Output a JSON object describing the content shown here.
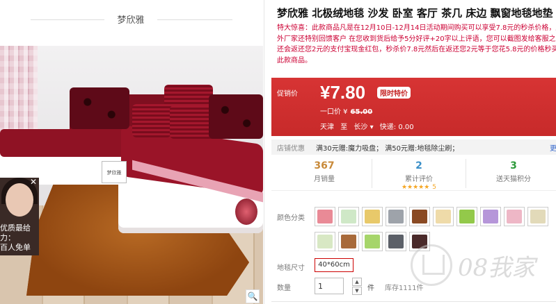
{
  "brand": {
    "name": "梦欣雅"
  },
  "gallery": {
    "tag_text": "梦欣雅",
    "ad": {
      "text": "优质最给力：\n百人免单",
      "close": "✕"
    },
    "zoom_icon": "🔍"
  },
  "product": {
    "title": "梦欣雅 北极绒地毯 沙发 卧室 客厅 茶几 床边 飘窗地毯地垫",
    "notice_lines": [
      "特大惊喜：此款商品凡是在12月10日-12月14日活动期间购买可以享受7.8元的秒杀价格，所",
      "外厂家还特别回馈客户 在您收到货后给予5分好评+20字以上评语，您可以截图发给客服之",
      "还会返还您2元的支付宝现金红包，秒杀价7.8元然后在返还您2元等于您花5.8元的价格秒买",
      "此款商品。"
    ]
  },
  "price": {
    "label": "促销价",
    "current": "¥7.80",
    "badge": "限时特价",
    "orig_label": "一口价 ¥",
    "orig_value": "65.00",
    "ship_from": "天津",
    "ship_to_prefix": "至",
    "ship_to": "长沙",
    "ship_to_arrow": "▾",
    "delivery": "快递: 0.00"
  },
  "promo": {
    "label": "店铺优惠",
    "items": "满30元赠:魔力吸盘；  满50元赠:地毯除尘刷；",
    "more": "更"
  },
  "stats": {
    "sales": {
      "value": "367",
      "label": "月销量"
    },
    "reviews": {
      "value": "2",
      "label": "累计评价",
      "stars": "★★★★★",
      "score": "5"
    },
    "points": {
      "value": "3",
      "label": "送天猫积分"
    }
  },
  "options": {
    "color_label": "颜色分类",
    "colors": [
      "#e98a96",
      "#cfe8c7",
      "#e8c96a",
      "#9ea3aa",
      "#8a4a23",
      "#efdba9",
      "#93c94a",
      "#b696d9",
      "#eeb7c6",
      "#e2dab9",
      "#d8e8c4",
      "#a86a3a",
      "#a6d56a",
      "#5c6068",
      "#4a2a2a"
    ],
    "size_label": "地毯尺寸",
    "size_value": "40*60cm",
    "qty_label": "数量",
    "qty_value": "1",
    "qty_up": "▲",
    "qty_down": "▼",
    "qty_unit": "件",
    "stock": "库存1111件"
  },
  "watermark": {
    "text": "08我家"
  }
}
